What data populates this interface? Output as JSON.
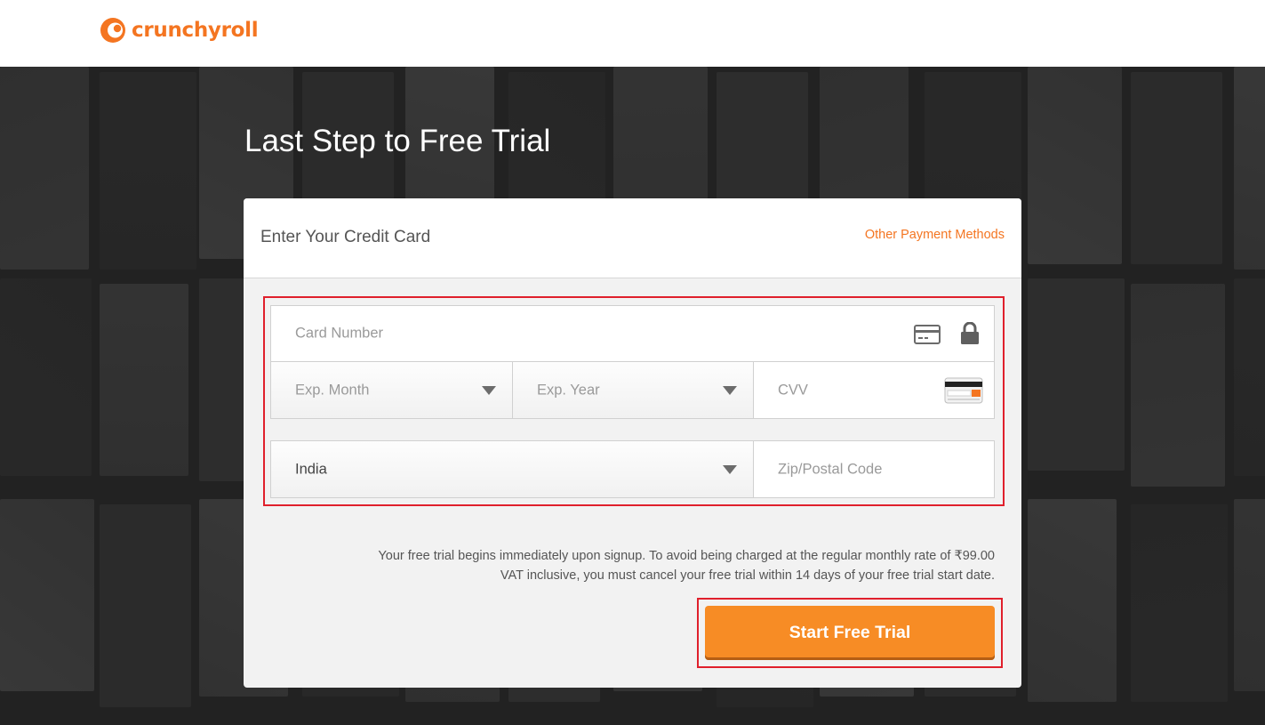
{
  "brand": {
    "name": "crunchyroll",
    "color": "#f47521",
    "logo_icon": "crunchyroll-logo-icon"
  },
  "page": {
    "title": "Last Step to Free Trial"
  },
  "card": {
    "title": "Enter Your Credit Card",
    "other_methods_link": "Other Payment Methods"
  },
  "form": {
    "card_number_placeholder": "Card Number",
    "card_icon": "credit-card-icon",
    "lock_icon": "lock-icon",
    "exp_month_placeholder": "Exp. Month",
    "exp_year_placeholder": "Exp. Year",
    "cvv_placeholder": "CVV",
    "cvv_icon": "cvv-card-icon",
    "country_value": "India",
    "zip_placeholder": "Zip/Postal Code"
  },
  "disclaimer": {
    "line1": "Your free trial begins immediately upon signup. To avoid being charged at the regular monthly rate of ₹99.00",
    "line2": "VAT inclusive, you must cancel your free trial within 14 days of your free trial start date."
  },
  "cta": {
    "label": "Start Free Trial",
    "color": "#f78c25"
  },
  "highlight_color": "#e0202c"
}
